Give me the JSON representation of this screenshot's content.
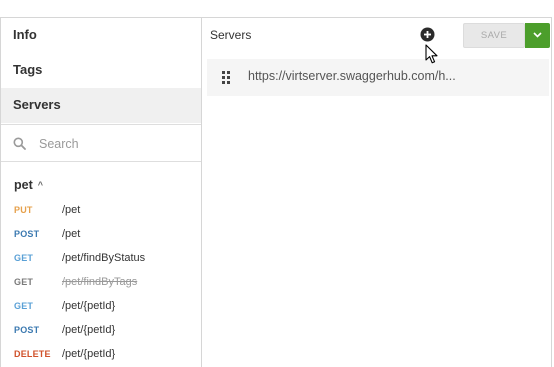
{
  "sidebar": {
    "items": [
      {
        "label": "Info"
      },
      {
        "label": "Tags"
      },
      {
        "label": "Servers",
        "active": true
      }
    ],
    "search": {
      "placeholder": "Search",
      "value": "",
      "icon": "search-icon"
    },
    "group": {
      "label": "pet",
      "expanded": true
    },
    "operations": [
      {
        "method": "PUT",
        "path": "/pet",
        "color": "#e6a04b"
      },
      {
        "method": "POST",
        "path": "/pet",
        "color": "#3b79b0"
      },
      {
        "method": "GET",
        "path": "/pet/findByStatus",
        "color": "#5aa0d6"
      },
      {
        "method": "GET",
        "path": "/pet/findByTags",
        "deprecated": true,
        "color": "#7a7a7a"
      },
      {
        "method": "GET",
        "path": "/pet/{petId}",
        "color": "#5aa0d6"
      },
      {
        "method": "POST",
        "path": "/pet/{petId}",
        "color": "#3b79b0"
      },
      {
        "method": "DELETE",
        "path": "/pet/{petId}",
        "color": "#d0512a"
      }
    ]
  },
  "main": {
    "title": "Servers",
    "add_icon": "plus-circle-icon",
    "save_label": "SAVE",
    "save_dropdown_icon": "chevron-down-icon",
    "accent": "#4c9e2b",
    "servers": [
      {
        "url": "https://virtserver.swaggerhub.com/h..."
      }
    ]
  }
}
